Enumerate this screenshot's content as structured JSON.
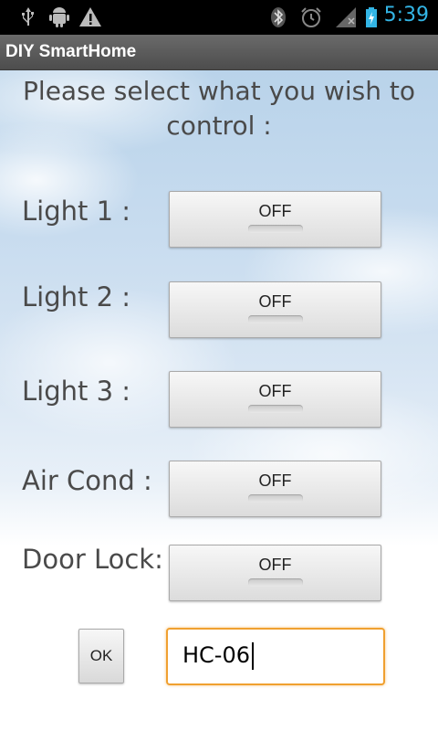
{
  "status_bar": {
    "time": "5:39",
    "icons": [
      "usb-icon",
      "android-debug-icon",
      "warning-icon",
      "bluetooth-icon",
      "alarm-icon",
      "signal-icon",
      "battery-charging-icon"
    ]
  },
  "app": {
    "title": "DIY SmartHome"
  },
  "main": {
    "heading_line1": "Please select what you wish to",
    "heading_line2": "control :",
    "controls": [
      {
        "label": "Light 1 :",
        "state": "OFF"
      },
      {
        "label": "Light 2 :",
        "state": "OFF"
      },
      {
        "label": "Light 3 :",
        "state": "OFF"
      },
      {
        "label": "Air Cond :",
        "state": "OFF"
      },
      {
        "label": "Door Lock:",
        "state": "OFF"
      }
    ],
    "ok_label": "OK",
    "device_name_value": "HC-06"
  },
  "colors": {
    "accent": "#33b5e5",
    "focus_border": "#f0a030"
  }
}
